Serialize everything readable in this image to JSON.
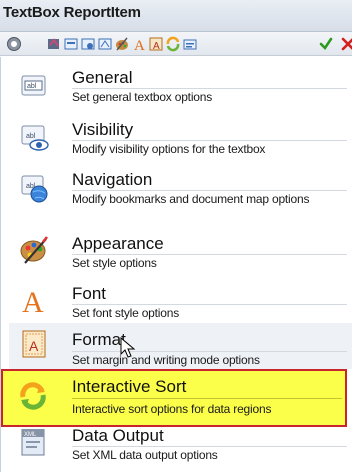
{
  "window": {
    "title": "TextBox ReportItem"
  },
  "toolbar": {
    "buttons": [
      {
        "icon": "back-icon"
      },
      {
        "icon": "general-icon"
      },
      {
        "icon": "visibility-icon"
      },
      {
        "icon": "navigation-icon"
      },
      {
        "icon": "format-icon"
      },
      {
        "icon": "appearance-icon"
      },
      {
        "icon": "font-icon"
      },
      {
        "icon": "format-page-icon"
      },
      {
        "icon": "interactive-sort-icon"
      },
      {
        "icon": "data-output-icon"
      },
      {
        "icon": "ok-check-icon"
      },
      {
        "icon": "cancel-x-icon"
      }
    ]
  },
  "pages": [
    {
      "name": "General",
      "desc": "Set general textbox options",
      "icon": "textbox-icon"
    },
    {
      "name": "Visibility",
      "desc": "Modify visibility options for the textbox",
      "icon": "visibility-eye-icon"
    },
    {
      "name": "Navigation",
      "desc": "Modify bookmarks and document map options",
      "icon": "navigation-globe-icon"
    },
    {
      "name": "Appearance",
      "desc": "Set style options",
      "icon": "palette-icon"
    },
    {
      "name": "Font",
      "desc": "Set font style options",
      "icon": "font-a-icon"
    },
    {
      "name": "Format",
      "desc": "Set margin and writing mode options",
      "icon": "format-page-icon"
    },
    {
      "name": "Interactive Sort",
      "desc": "Interactive sort options for data regions",
      "icon": "sort-arrows-icon"
    },
    {
      "name": "Data Output",
      "desc": "Set XML data output options",
      "icon": "xml-icon"
    }
  ],
  "colors": {
    "highlight": "#fcff4a",
    "highlight_border": "#c9252c",
    "title_bg": "#dde3eb"
  }
}
